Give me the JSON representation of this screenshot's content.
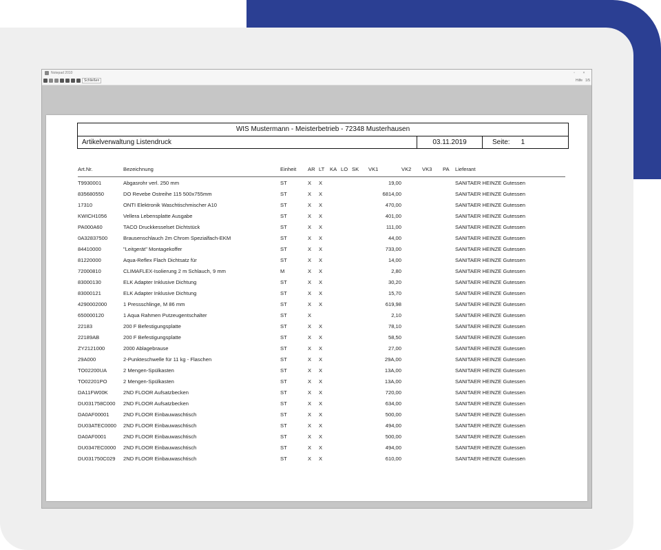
{
  "window": {
    "title": "Notepad 2010",
    "toolbar_button": "Schließen",
    "toolbar_right": [
      "Hilfe",
      "1/5"
    ]
  },
  "report": {
    "company_line": "WIS Mustermann  -  Meisterbetrieb  -  72348 Musterhausen",
    "title": "Artikelverwaltung Listendruck",
    "date": "03.11.2019",
    "page_label": "Seite:",
    "page_number": "1"
  },
  "columns": {
    "art": "Art.Nr.",
    "bez": "Bezeichnung",
    "einh": "Einheit",
    "ar": "AR",
    "lt": "LT",
    "ka": "KA",
    "lo": "LO",
    "sk": "SK",
    "vk1": "VK1",
    "vk2": "VK2",
    "vk3": "VK3",
    "pa": "PA",
    "lief": "Lieferant"
  },
  "rows": [
    {
      "art": "T9930001",
      "bez": "Abgasrohr verl. 250 mm",
      "einh": "ST",
      "ar": "X",
      "lt": "X",
      "vk1": "19,00",
      "lief": "SANITAER HEINZE Gutessen"
    },
    {
      "art": "835680550",
      "bez": "DO Revebe Ostreihe 115 500x755mm",
      "einh": "ST",
      "ar": "X",
      "lt": "X",
      "vk1": "6814,00",
      "lief": "SANITAER HEINZE Gutessen"
    },
    {
      "art": "17310",
      "bez": "ONTI Elektronik Waschtischmischer A10",
      "einh": "ST",
      "ar": "X",
      "lt": "X",
      "vk1": "470,00",
      "lief": "SANITAER HEINZE Gutessen"
    },
    {
      "art": "KWICH1056",
      "bez": "Vellera Lebensplatte Ausgabe",
      "einh": "ST",
      "ar": "X",
      "lt": "X",
      "vk1": "401,00",
      "lief": "SANITAER HEINZE Gutessen"
    },
    {
      "art": "PA000A60",
      "bez": "TACO Druckkesselset Dichtstück",
      "einh": "ST",
      "ar": "X",
      "lt": "X",
      "vk1": "111,00",
      "lief": "SANITAER HEINZE Gutessen"
    },
    {
      "art": "0A32837500",
      "bez": "Brausenschlauch 2m Chrom Spezialfach-EKM",
      "einh": "ST",
      "ar": "X",
      "lt": "X",
      "vk1": "44,00",
      "lief": "SANITAER HEINZE Gutessen"
    },
    {
      "art": "84410000",
      "bez": "\"Leitgerät\" Montagekoffer",
      "einh": "ST",
      "ar": "X",
      "lt": "X",
      "vk1": "733,00",
      "lief": "SANITAER HEINZE Gutessen"
    },
    {
      "art": "81220000",
      "bez": "Aqua-Reflex Flach Dichtsatz für",
      "einh": "ST",
      "ar": "X",
      "lt": "X",
      "vk1": "14,00",
      "lief": "SANITAER HEINZE Gutessen"
    },
    {
      "art": "72000810",
      "bez": "CLIMAFLEX-Isolierung 2 m Schlauch, 9 mm",
      "einh": "M",
      "ar": "X",
      "lt": "X",
      "vk1": "2,80",
      "lief": "SANITAER HEINZE Gutessen"
    },
    {
      "art": "83000130",
      "bez": "ELK Adapter Inklusive Dichtung",
      "einh": "ST",
      "ar": "X",
      "lt": "X",
      "vk1": "30,20",
      "lief": "SANITAER HEINZE Gutessen"
    },
    {
      "art": "83000121",
      "bez": "ELK Adapter Inklusive Dichtung",
      "einh": "ST",
      "ar": "X",
      "lt": "X",
      "vk1": "15,70",
      "lief": "SANITAER HEINZE Gutessen"
    },
    {
      "art": "4290002000",
      "bez": "1 Pressschlinge, M 86 mm",
      "einh": "ST",
      "ar": "X",
      "lt": "X",
      "vk1": "619,98",
      "lief": "SANITAER HEINZE Gutessen"
    },
    {
      "art": "650000120",
      "bez": "1 Aqua Rahmen Putzeugentschalter",
      "einh": "ST",
      "ar": "X",
      "lt": "",
      "vk1": "2,10",
      "lief": "SANITAER HEINZE Gutessen"
    },
    {
      "art": "22183",
      "bez": "200 F Befestigungsplatte",
      "einh": "ST",
      "ar": "X",
      "lt": "X",
      "vk1": "78,10",
      "lief": "SANITAER HEINZE Gutessen"
    },
    {
      "art": "22189AB",
      "bez": "200 F Befestigungsplatte",
      "einh": "ST",
      "ar": "X",
      "lt": "X",
      "vk1": "58,50",
      "lief": "SANITAER HEINZE Gutessen"
    },
    {
      "art": "ZY2121000",
      "bez": "2000 Ablagebrause",
      "einh": "ST",
      "ar": "X",
      "lt": "X",
      "vk1": "27,00",
      "lief": "SANITAER HEINZE Gutessen"
    },
    {
      "art": "29A000",
      "bez": "2-Punkteschwelle für 11 kg - Flaschen",
      "einh": "ST",
      "ar": "X",
      "lt": "X",
      "vk1": "29A,00",
      "lief": "SANITAER HEINZE Gutessen"
    },
    {
      "art": "TO02200UA",
      "bez": "2 Mengen-Spülkasten",
      "einh": "ST",
      "ar": "X",
      "lt": "X",
      "vk1": "13A,00",
      "lief": "SANITAER HEINZE Gutessen"
    },
    {
      "art": "TO02201PO",
      "bez": "2 Mengen-Spülkasten",
      "einh": "ST",
      "ar": "X",
      "lt": "X",
      "vk1": "13A,00",
      "lief": "SANITAER HEINZE Gutessen"
    },
    {
      "art": "DA11FW00K",
      "bez": "2ND FLOOR Aufsatzbecken",
      "einh": "ST",
      "ar": "X",
      "lt": "X",
      "vk1": "720,00",
      "lief": "SANITAER HEINZE Gutessen"
    },
    {
      "art": "DU031758C000",
      "bez": "2ND FLOOR Aufsatzbecken",
      "einh": "ST",
      "ar": "X",
      "lt": "X",
      "vk1": "634,00",
      "lief": "SANITAER HEINZE Gutessen"
    },
    {
      "art": "DA0AF00001",
      "bez": "2ND FLOOR Einbauwaschtisch",
      "einh": "ST",
      "ar": "X",
      "lt": "X",
      "vk1": "500,00",
      "lief": "SANITAER HEINZE Gutessen"
    },
    {
      "art": "DU03ATEC0000",
      "bez": "2ND FLOOR Einbauwaschtisch",
      "einh": "ST",
      "ar": "X",
      "lt": "X",
      "vk1": "494,00",
      "lief": "SANITAER HEINZE Gutessen"
    },
    {
      "art": "DA0AF0001",
      "bez": "2ND FLOOR Einbauwaschtisch",
      "einh": "ST",
      "ar": "X",
      "lt": "X",
      "vk1": "500,00",
      "lief": "SANITAER HEINZE Gutessen"
    },
    {
      "art": "DU0347EC0000",
      "bez": "2ND FLOOR Einbauwaschtisch",
      "einh": "ST",
      "ar": "X",
      "lt": "X",
      "vk1": "494,00",
      "lief": "SANITAER HEINZE Gutessen"
    },
    {
      "art": "DU031750C029",
      "bez": "2ND FLOOR Einbauwaschtisch",
      "einh": "ST",
      "ar": "X",
      "lt": "X",
      "vk1": "610,00",
      "lief": "SANITAER HEINZE Gutessen"
    }
  ]
}
